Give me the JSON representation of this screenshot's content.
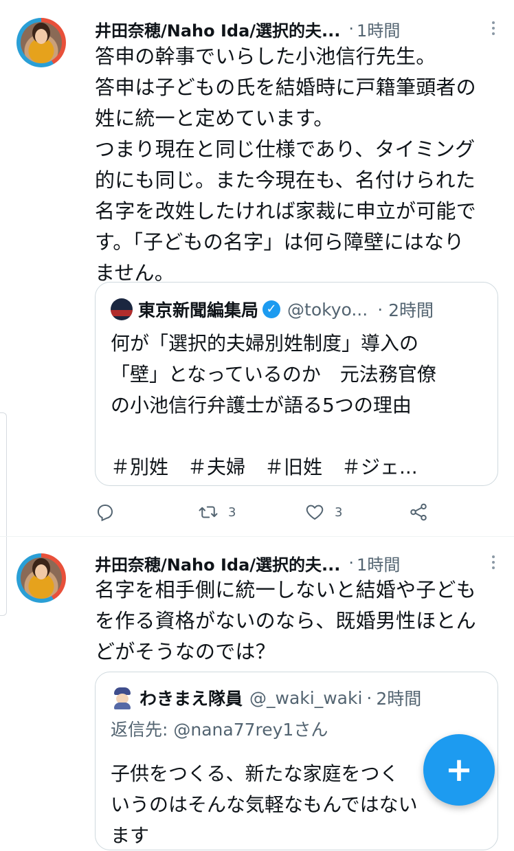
{
  "tweet1": {
    "author": "井田奈穂/Naho Ida/選択的夫...",
    "separator": "·",
    "time": "1時間",
    "text_lines": [
      "答申の幹事でいらした小池信行先生。",
      "答申は子どもの氏を結婚時に戸籍筆頭者の",
      "姓に統一と定めています。",
      "つまり現在と同じ仕様であり、タイミング",
      "的にも同じ。また今現在も、名付けられた",
      "名字を改姓したければ家裁に申立が可能で",
      "す。「子どもの名字」は何ら障壁にはなり",
      "ません。"
    ],
    "quote": {
      "name": "東京新聞編集局",
      "handle": "@tokyo...",
      "separator": "·",
      "time": "2時間",
      "text_lines": [
        "何が「選択的夫婦別姓制度」導入の",
        "「壁」となっているのか　元法務官僚",
        "の小池信行弁護士が語る5つの理由",
        "",
        "＃別姓　＃夫婦　＃旧姓　＃ジェ..."
      ]
    },
    "actions": {
      "reply_count": "",
      "retweet_count": "3",
      "like_count": "3"
    }
  },
  "tweet2": {
    "author": "井田奈穂/Naho Ida/選択的夫...",
    "separator": "·",
    "time": "1時間",
    "text_lines": [
      "名字を相手側に統一しないと結婚や子ども",
      "を作る資格がないのなら、既婚男性ほとん",
      "どがそうなのでは？"
    ],
    "quote": {
      "name": "わきまえ隊員",
      "handle": "@_waki_waki",
      "separator": "·",
      "time": "2時間",
      "reply_to": "返信先: @nana77rey1さん",
      "text_lines": [
        "子供をつくる、新たな家庭をつく",
        "いうのはそんな気軽なもんではない",
        "ます"
      ]
    }
  },
  "fab": {
    "label": "+"
  },
  "colors": {
    "accent": "#1d9bf0",
    "muted": "#536471",
    "border": "#cfd9de"
  },
  "icons": [
    "reply-icon",
    "retweet-icon",
    "like-icon",
    "share-icon",
    "more-icon",
    "verified-icon",
    "compose-icon"
  ]
}
